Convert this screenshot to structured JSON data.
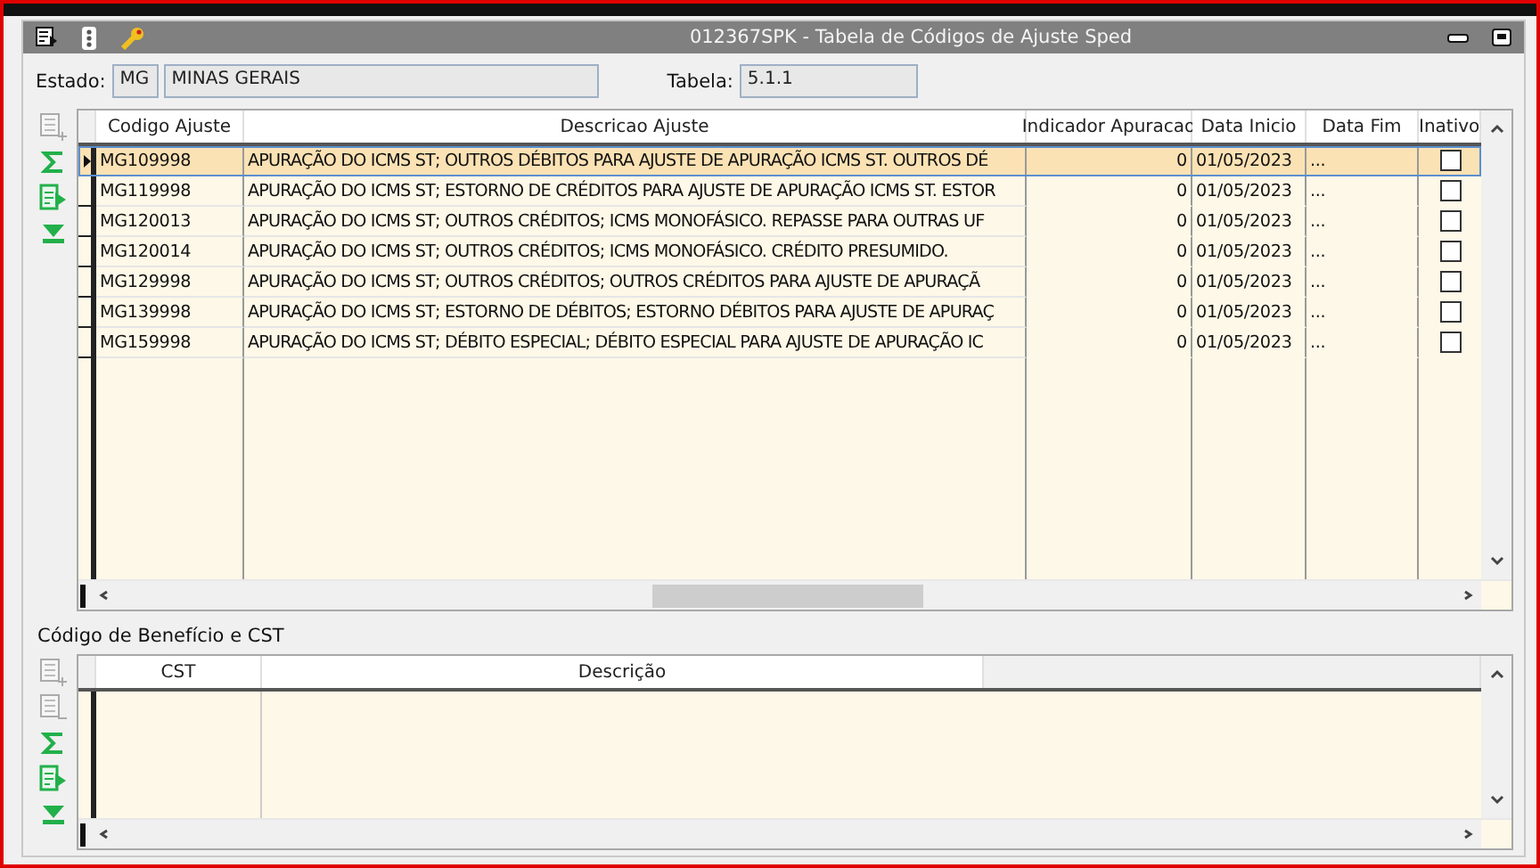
{
  "window": {
    "title": "012367SPK - Tabela de Códigos de Ajuste Sped"
  },
  "header": {
    "estado_label": "Estado:",
    "estado_code": "MG",
    "estado_name": "MINAS GERAIS",
    "tabela_label": "Tabela:",
    "tabela": "5.1.1"
  },
  "adjustments": {
    "tools": [
      {
        "kind": "add-row",
        "disabled": true
      },
      {
        "kind": "sum",
        "disabled": false
      },
      {
        "kind": "export",
        "disabled": false
      },
      {
        "kind": "last",
        "disabled": false
      }
    ],
    "columns": [
      "Codigo Ajuste",
      "Descricao Ajuste",
      "Indicador Apuracao",
      "Data Inicio",
      "Data Fim",
      "Inativo"
    ],
    "rows": [
      {
        "codigo": "MG109998",
        "descricao": "APURAÇÃO DO ICMS ST; OUTROS DÉBITOS PARA AJUSTE DE APURAÇÃO ICMS ST. OUTROS DÉ",
        "indicador": "0",
        "data_inicio": "01/05/2023",
        "data_fim": "...",
        "inativo": false,
        "selected": true
      },
      {
        "codigo": "MG119998",
        "descricao": "APURAÇÃO DO ICMS ST; ESTORNO DE CRÉDITOS PARA AJUSTE DE APURAÇÃO ICMS ST. ESTOR",
        "indicador": "0",
        "data_inicio": "01/05/2023",
        "data_fim": "...",
        "inativo": false,
        "selected": false
      },
      {
        "codigo": "MG120013",
        "descricao": "APURAÇÃO DO ICMS ST; OUTROS CRÉDITOS; ICMS MONOFÁSICO. REPASSE PARA OUTRAS UF",
        "indicador": "0",
        "data_inicio": "01/05/2023",
        "data_fim": "...",
        "inativo": false,
        "selected": false
      },
      {
        "codigo": "MG120014",
        "descricao": "APURAÇÃO DO ICMS ST; OUTROS CRÉDITOS; ICMS MONOFÁSICO. CRÉDITO PRESUMIDO.",
        "indicador": "0",
        "data_inicio": "01/05/2023",
        "data_fim": "...",
        "inativo": false,
        "selected": false
      },
      {
        "codigo": "MG129998",
        "descricao": "APURAÇÃO DO ICMS ST; OUTROS CRÉDITOS; OUTROS CRÉDITOS PARA AJUSTE DE APURAÇÃ",
        "indicador": "0",
        "data_inicio": "01/05/2023",
        "data_fim": "...",
        "inativo": false,
        "selected": false
      },
      {
        "codigo": "MG139998",
        "descricao": "APURAÇÃO DO ICMS ST; ESTORNO DE DÉBITOS; ESTORNO DÉBITOS PARA AJUSTE DE APURAÇ",
        "indicador": "0",
        "data_inicio": "01/05/2023",
        "data_fim": "...",
        "inativo": false,
        "selected": false
      },
      {
        "codigo": "MG159998",
        "descricao": "APURAÇÃO DO ICMS ST; DÉBITO ESPECIAL; DÉBITO ESPECIAL PARA AJUSTE DE APURAÇÃO IC",
        "indicador": "0",
        "data_inicio": "01/05/2023",
        "data_fim": "...",
        "inativo": false,
        "selected": false
      }
    ]
  },
  "benefits": {
    "title": "Código de Benefício e CST",
    "tools": [
      {
        "kind": "add-row",
        "disabled": true
      },
      {
        "kind": "remove-row",
        "disabled": true
      },
      {
        "kind": "sum",
        "disabled": false
      },
      {
        "kind": "export",
        "disabled": false
      },
      {
        "kind": "last",
        "disabled": false
      }
    ],
    "columns": [
      "CST",
      "Descrição"
    ]
  }
}
